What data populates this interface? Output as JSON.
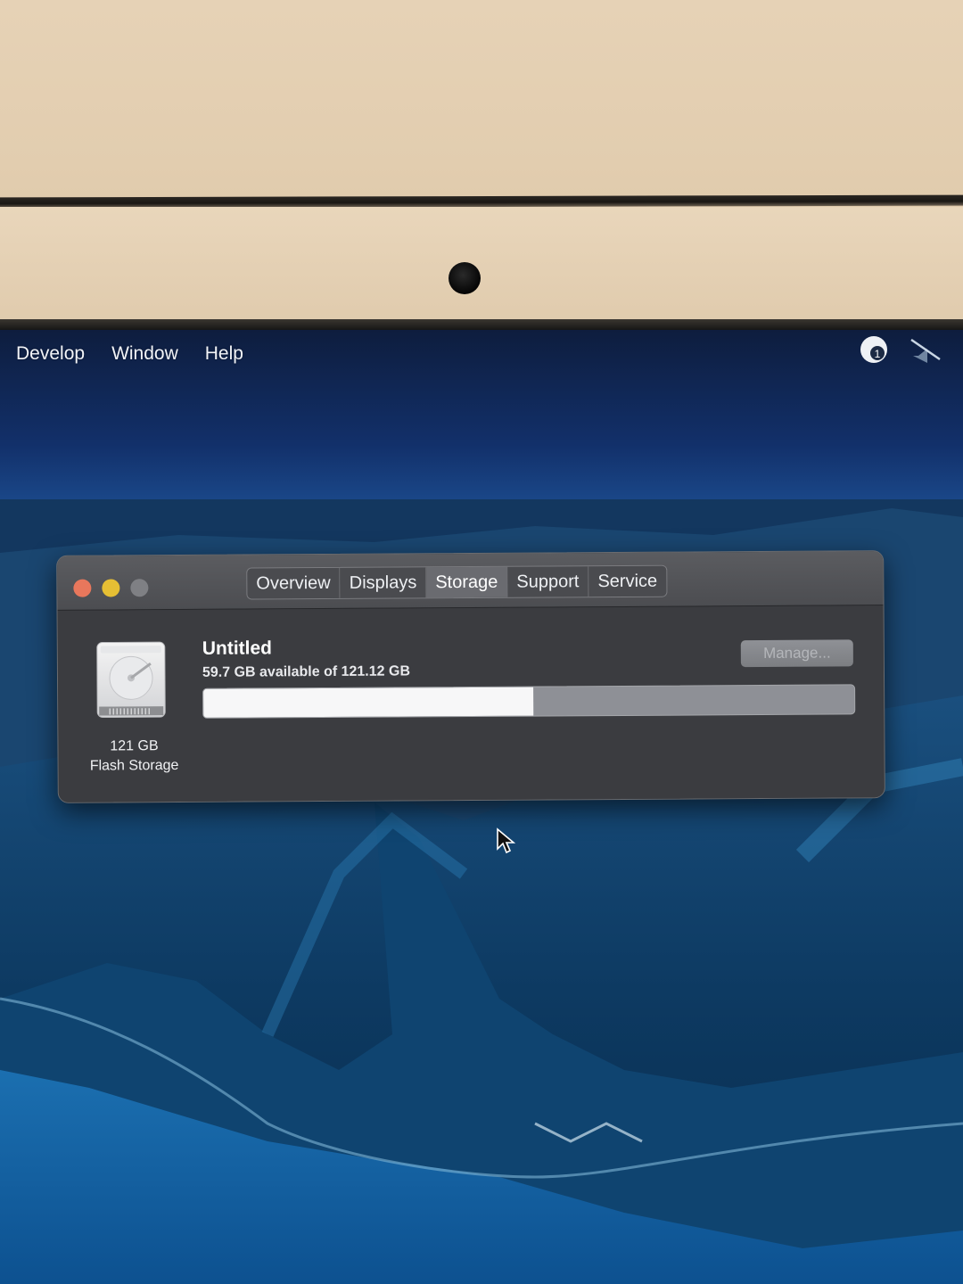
{
  "menubar": {
    "items": [
      "Develop",
      "Window",
      "Help"
    ],
    "icons": [
      "wifi-icon",
      "mute-icon"
    ],
    "badge": "1"
  },
  "window": {
    "tabs": [
      {
        "label": "Overview",
        "active": false
      },
      {
        "label": "Displays",
        "active": false
      },
      {
        "label": "Storage",
        "active": true
      },
      {
        "label": "Support",
        "active": false
      },
      {
        "label": "Service",
        "active": false
      }
    ],
    "disk": {
      "size": "121 GB",
      "type": "Flash Storage"
    },
    "volume": {
      "name": "Untitled",
      "available": "59.7 GB available of 121.12 GB",
      "used_fraction": 0.507
    },
    "manage_label": "Manage..."
  },
  "colors": {
    "close": "#e8775c",
    "minimize": "#e6bf34",
    "zoom": "#7f8084",
    "used_bar": "#f7f7f8",
    "free_bar": "#8e9096"
  }
}
